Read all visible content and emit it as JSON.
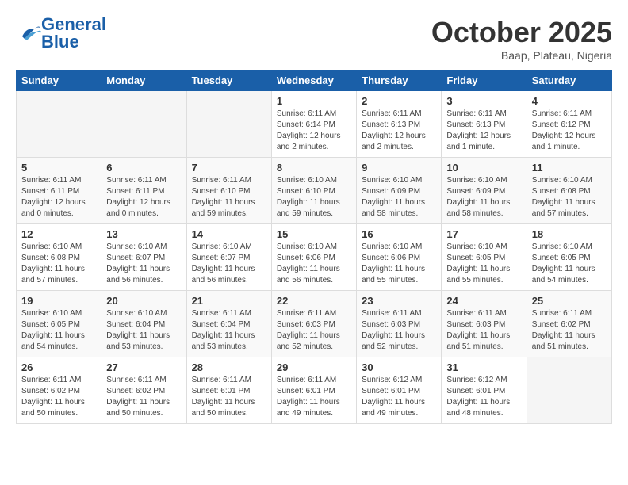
{
  "logo": {
    "text_general": "General",
    "text_blue": "Blue"
  },
  "header": {
    "title": "October 2025",
    "location": "Baap, Plateau, Nigeria"
  },
  "weekdays": [
    "Sunday",
    "Monday",
    "Tuesday",
    "Wednesday",
    "Thursday",
    "Friday",
    "Saturday"
  ],
  "weeks": [
    [
      {
        "day": "",
        "sunrise": "",
        "sunset": "",
        "daylight": ""
      },
      {
        "day": "",
        "sunrise": "",
        "sunset": "",
        "daylight": ""
      },
      {
        "day": "",
        "sunrise": "",
        "sunset": "",
        "daylight": ""
      },
      {
        "day": "1",
        "sunrise": "Sunrise: 6:11 AM",
        "sunset": "Sunset: 6:14 PM",
        "daylight": "Daylight: 12 hours and 2 minutes."
      },
      {
        "day": "2",
        "sunrise": "Sunrise: 6:11 AM",
        "sunset": "Sunset: 6:13 PM",
        "daylight": "Daylight: 12 hours and 2 minutes."
      },
      {
        "day": "3",
        "sunrise": "Sunrise: 6:11 AM",
        "sunset": "Sunset: 6:13 PM",
        "daylight": "Daylight: 12 hours and 1 minute."
      },
      {
        "day": "4",
        "sunrise": "Sunrise: 6:11 AM",
        "sunset": "Sunset: 6:12 PM",
        "daylight": "Daylight: 12 hours and 1 minute."
      }
    ],
    [
      {
        "day": "5",
        "sunrise": "Sunrise: 6:11 AM",
        "sunset": "Sunset: 6:11 PM",
        "daylight": "Daylight: 12 hours and 0 minutes."
      },
      {
        "day": "6",
        "sunrise": "Sunrise: 6:11 AM",
        "sunset": "Sunset: 6:11 PM",
        "daylight": "Daylight: 12 hours and 0 minutes."
      },
      {
        "day": "7",
        "sunrise": "Sunrise: 6:11 AM",
        "sunset": "Sunset: 6:10 PM",
        "daylight": "Daylight: 11 hours and 59 minutes."
      },
      {
        "day": "8",
        "sunrise": "Sunrise: 6:10 AM",
        "sunset": "Sunset: 6:10 PM",
        "daylight": "Daylight: 11 hours and 59 minutes."
      },
      {
        "day": "9",
        "sunrise": "Sunrise: 6:10 AM",
        "sunset": "Sunset: 6:09 PM",
        "daylight": "Daylight: 11 hours and 58 minutes."
      },
      {
        "day": "10",
        "sunrise": "Sunrise: 6:10 AM",
        "sunset": "Sunset: 6:09 PM",
        "daylight": "Daylight: 11 hours and 58 minutes."
      },
      {
        "day": "11",
        "sunrise": "Sunrise: 6:10 AM",
        "sunset": "Sunset: 6:08 PM",
        "daylight": "Daylight: 11 hours and 57 minutes."
      }
    ],
    [
      {
        "day": "12",
        "sunrise": "Sunrise: 6:10 AM",
        "sunset": "Sunset: 6:08 PM",
        "daylight": "Daylight: 11 hours and 57 minutes."
      },
      {
        "day": "13",
        "sunrise": "Sunrise: 6:10 AM",
        "sunset": "Sunset: 6:07 PM",
        "daylight": "Daylight: 11 hours and 56 minutes."
      },
      {
        "day": "14",
        "sunrise": "Sunrise: 6:10 AM",
        "sunset": "Sunset: 6:07 PM",
        "daylight": "Daylight: 11 hours and 56 minutes."
      },
      {
        "day": "15",
        "sunrise": "Sunrise: 6:10 AM",
        "sunset": "Sunset: 6:06 PM",
        "daylight": "Daylight: 11 hours and 56 minutes."
      },
      {
        "day": "16",
        "sunrise": "Sunrise: 6:10 AM",
        "sunset": "Sunset: 6:06 PM",
        "daylight": "Daylight: 11 hours and 55 minutes."
      },
      {
        "day": "17",
        "sunrise": "Sunrise: 6:10 AM",
        "sunset": "Sunset: 6:05 PM",
        "daylight": "Daylight: 11 hours and 55 minutes."
      },
      {
        "day": "18",
        "sunrise": "Sunrise: 6:10 AM",
        "sunset": "Sunset: 6:05 PM",
        "daylight": "Daylight: 11 hours and 54 minutes."
      }
    ],
    [
      {
        "day": "19",
        "sunrise": "Sunrise: 6:10 AM",
        "sunset": "Sunset: 6:05 PM",
        "daylight": "Daylight: 11 hours and 54 minutes."
      },
      {
        "day": "20",
        "sunrise": "Sunrise: 6:10 AM",
        "sunset": "Sunset: 6:04 PM",
        "daylight": "Daylight: 11 hours and 53 minutes."
      },
      {
        "day": "21",
        "sunrise": "Sunrise: 6:11 AM",
        "sunset": "Sunset: 6:04 PM",
        "daylight": "Daylight: 11 hours and 53 minutes."
      },
      {
        "day": "22",
        "sunrise": "Sunrise: 6:11 AM",
        "sunset": "Sunset: 6:03 PM",
        "daylight": "Daylight: 11 hours and 52 minutes."
      },
      {
        "day": "23",
        "sunrise": "Sunrise: 6:11 AM",
        "sunset": "Sunset: 6:03 PM",
        "daylight": "Daylight: 11 hours and 52 minutes."
      },
      {
        "day": "24",
        "sunrise": "Sunrise: 6:11 AM",
        "sunset": "Sunset: 6:03 PM",
        "daylight": "Daylight: 11 hours and 51 minutes."
      },
      {
        "day": "25",
        "sunrise": "Sunrise: 6:11 AM",
        "sunset": "Sunset: 6:02 PM",
        "daylight": "Daylight: 11 hours and 51 minutes."
      }
    ],
    [
      {
        "day": "26",
        "sunrise": "Sunrise: 6:11 AM",
        "sunset": "Sunset: 6:02 PM",
        "daylight": "Daylight: 11 hours and 50 minutes."
      },
      {
        "day": "27",
        "sunrise": "Sunrise: 6:11 AM",
        "sunset": "Sunset: 6:02 PM",
        "daylight": "Daylight: 11 hours and 50 minutes."
      },
      {
        "day": "28",
        "sunrise": "Sunrise: 6:11 AM",
        "sunset": "Sunset: 6:01 PM",
        "daylight": "Daylight: 11 hours and 50 minutes."
      },
      {
        "day": "29",
        "sunrise": "Sunrise: 6:11 AM",
        "sunset": "Sunset: 6:01 PM",
        "daylight": "Daylight: 11 hours and 49 minutes."
      },
      {
        "day": "30",
        "sunrise": "Sunrise: 6:12 AM",
        "sunset": "Sunset: 6:01 PM",
        "daylight": "Daylight: 11 hours and 49 minutes."
      },
      {
        "day": "31",
        "sunrise": "Sunrise: 6:12 AM",
        "sunset": "Sunset: 6:01 PM",
        "daylight": "Daylight: 11 hours and 48 minutes."
      },
      {
        "day": "",
        "sunrise": "",
        "sunset": "",
        "daylight": ""
      }
    ]
  ]
}
